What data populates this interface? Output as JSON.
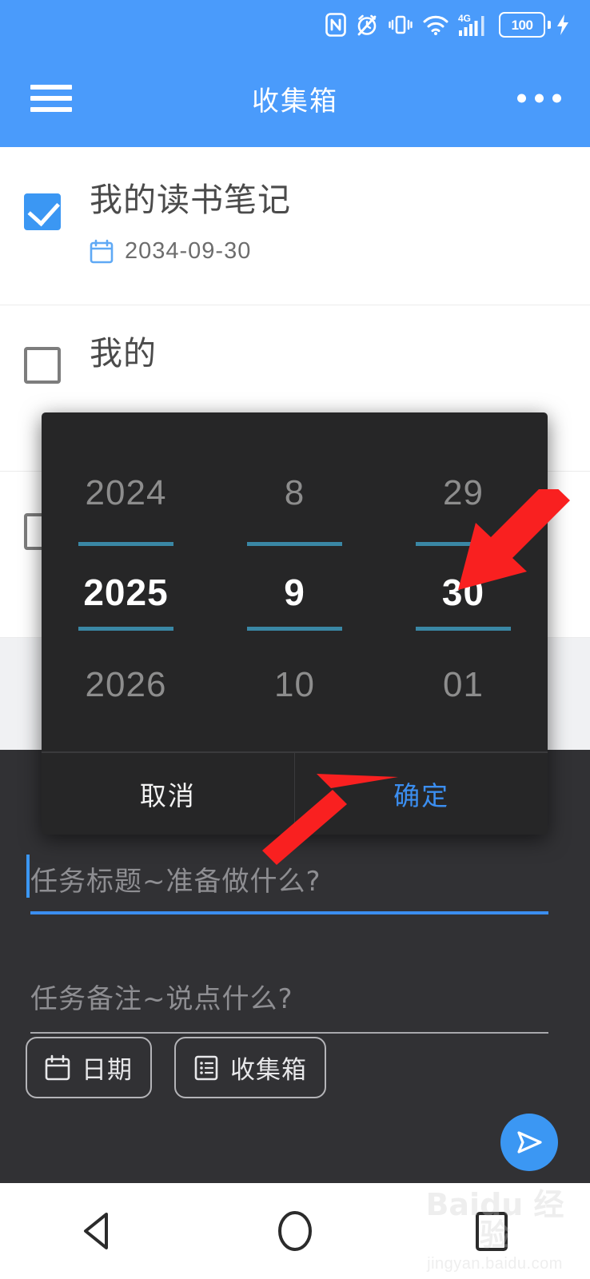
{
  "status_bar": {
    "battery_percent": "100",
    "icons": [
      "nfc-icon",
      "alarm-off-icon",
      "vibrate-icon",
      "wifi-icon",
      "signal-4g-icon",
      "battery-icon",
      "charging-bolt-icon"
    ]
  },
  "app_bar": {
    "title": "收集箱",
    "menu_icon": "hamburger-icon",
    "overflow_icon": "more-options-icon"
  },
  "task_list": [
    {
      "title": "我的读书笔记",
      "checked": true,
      "date": "2034-09-30",
      "date_icon": "calendar-icon"
    },
    {
      "title": "我的",
      "checked": false,
      "date": "",
      "date_icon": ""
    },
    {
      "title": "",
      "checked": false,
      "date": "",
      "date_icon": ""
    }
  ],
  "date_picker": {
    "columns": [
      {
        "name": "year",
        "prev": "2024",
        "current": "2025",
        "next": "2026"
      },
      {
        "name": "month",
        "prev": "8",
        "current": "9",
        "next": "10"
      },
      {
        "name": "day",
        "prev": "29",
        "current": "30",
        "next": "01"
      }
    ],
    "cancel_label": "取消",
    "confirm_label": "确定",
    "accent_color": "#3a87a5",
    "confirm_color": "#3b8ef0"
  },
  "compose": {
    "title_placeholder": "任务标题~准备做什么?",
    "note_placeholder": "任务备注~说点什么?",
    "chips": [
      {
        "label": "日期",
        "icon": "calendar-icon"
      },
      {
        "label": "收集箱",
        "icon": "list-icon"
      }
    ],
    "send_icon": "send-icon"
  },
  "nav_bar": {
    "back": "back-triangle-icon",
    "home": "home-circle-icon",
    "recents": "recents-square-icon"
  },
  "annotations": [
    {
      "name": "arrow-to-day-value",
      "color": "#f92020",
      "direction": "down-left"
    },
    {
      "name": "arrow-to-confirm",
      "color": "#f92020",
      "direction": "up-right"
    }
  ],
  "watermark": {
    "main": "Baidu 经验",
    "sub": "jingyan.baidu.com"
  },
  "theme": {
    "primary": "#4a9bfb",
    "accent": "#3b97f3",
    "sheet_bg": "#313134",
    "dialog_bg": "#262627"
  }
}
